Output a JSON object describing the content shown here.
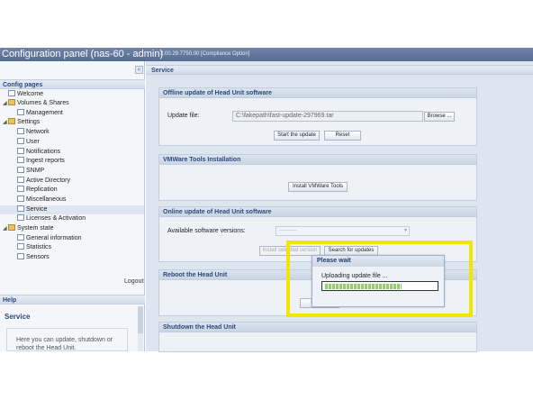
{
  "window": {
    "title": "Configuration panel (nas-60 - admin)",
    "version": "2.00.29.7750.00 [Compliance Option]"
  },
  "sidebar": {
    "collapse_glyph": "«",
    "config_header": "Config pages",
    "items": [
      {
        "label": "Welcome"
      },
      {
        "label": "Volumes & Shares"
      },
      {
        "label": "Management"
      },
      {
        "label": "Settings"
      },
      {
        "label": "Network"
      },
      {
        "label": "User"
      },
      {
        "label": "Notifications"
      },
      {
        "label": "Ingest reports"
      },
      {
        "label": "SNMP"
      },
      {
        "label": "Active Directory"
      },
      {
        "label": "Replication"
      },
      {
        "label": "Miscellaneous"
      },
      {
        "label": "Service"
      },
      {
        "label": "Licenses & Activation"
      },
      {
        "label": "System state"
      },
      {
        "label": "General information"
      },
      {
        "label": "Statistics"
      },
      {
        "label": "Sensors"
      }
    ],
    "logout_label": "Logout",
    "help_header": "Help",
    "help_title": "Service",
    "help_text": "Here you can update, shutdown or reboot the Head Unit."
  },
  "main": {
    "header": "Service",
    "offline": {
      "title": "Offline update of Head Unit software",
      "file_label": "Update file:",
      "file_value": "C:\\fakepath\\fast-update-297969.tar",
      "browse_label": "Browse ...",
      "start_label": "Start the update",
      "reset_label": "Reset"
    },
    "vmware": {
      "title": "VMWare Tools Installation",
      "install_label": "Install VMWare Tools"
    },
    "online": {
      "title": "Online update of Head Unit software",
      "versions_label": "Available software versions:",
      "versions_value": "----------",
      "install_selected_label": "Install selected version",
      "search_label": "Search for updates"
    },
    "reboot": {
      "title": "Reboot the Head Unit",
      "reboot_label": "Reboot"
    },
    "shutdown": {
      "title": "Shutdown the Head Unit"
    }
  },
  "dialog": {
    "title": "Please wait",
    "message": "Uploading update file ...",
    "progress_fraction": 0.7
  },
  "colors": {
    "highlight": "#f2e500",
    "progress": "#8fcf6a",
    "accent": "#2b4a7b"
  }
}
